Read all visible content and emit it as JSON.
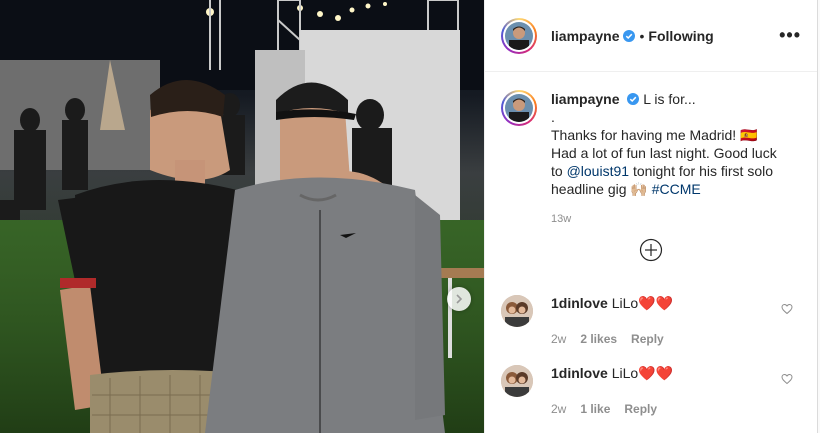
{
  "post": {
    "author": "liampayne",
    "follow_status": "Following",
    "separator": "•",
    "more_label": "•••",
    "caption_username": "liampayne",
    "caption_line1": "L is for...",
    "caption_line2": ".",
    "caption_line3": "Thanks for having me Madrid! 🇪🇸",
    "caption_line4": "Had a lot of fun last night. Good luck",
    "caption_to": "to",
    "caption_mention": "@louist91",
    "caption_line5_rest": "tonight for his first solo",
    "caption_line6_start": "headline gig 🙌🏼",
    "caption_hashtag": "#CCME",
    "time_ago": "13w"
  },
  "comments": [
    {
      "username": "1dinlove",
      "text": "LiLo❤️❤️",
      "time": "2w",
      "likes": "2 likes",
      "reply": "Reply"
    },
    {
      "username": "1dinlove",
      "text": "LiLo❤️❤️",
      "time": "2w",
      "likes": "1 like",
      "reply": "Reply"
    }
  ],
  "colors": {
    "link": "#00376b",
    "verified": "#3897f0",
    "muted": "#8e8e8e"
  },
  "icons": [
    "verified-badge-icon",
    "more-options-icon",
    "plus-circle-icon",
    "heart-outline-icon",
    "chevron-right-icon"
  ]
}
